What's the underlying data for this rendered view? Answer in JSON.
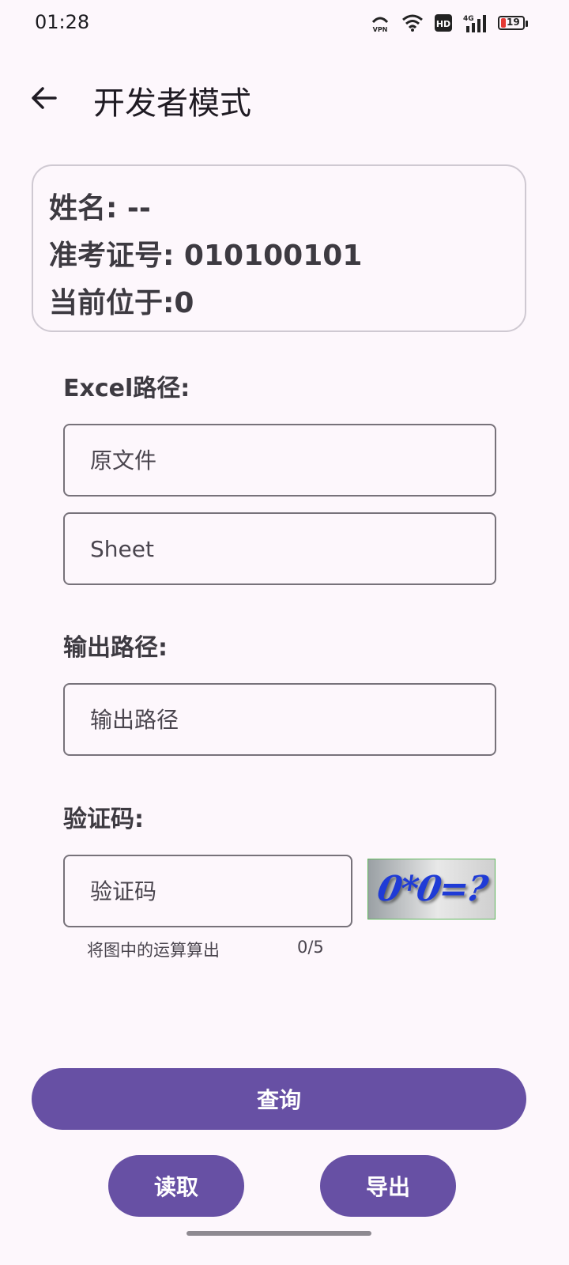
{
  "status_bar": {
    "time": "01:28",
    "icons": [
      "vpn-icon",
      "wifi-icon",
      "hd-icon",
      "signal-4g-icon",
      "battery-icon"
    ],
    "hd_label": "HD",
    "network_label": "4G",
    "vpn_label": "VPN",
    "battery_level": "19"
  },
  "header": {
    "back_icon": "arrow-left-icon",
    "title": "开发者模式"
  },
  "info_card": {
    "name_line": "姓名: --",
    "exam_id_line": "准考证号:  010100101",
    "position_line": "当前位于:0"
  },
  "excel_section": {
    "label": "Excel路径:",
    "source_placeholder": "原文件",
    "sheet_placeholder": "Sheet"
  },
  "output_section": {
    "label": "输出路径:",
    "output_placeholder": "输出路径"
  },
  "captcha_section": {
    "label": "验证码:",
    "input_placeholder": "验证码",
    "image_text": "0*0=?",
    "helper": "将图中的运算算出",
    "counter": "0/5"
  },
  "actions": {
    "query_label": "查询",
    "read_label": "读取",
    "export_label": "导出"
  },
  "colors": {
    "accent": "#6750a4",
    "background": "#fdf7fc",
    "battery_low": "#e53935"
  }
}
